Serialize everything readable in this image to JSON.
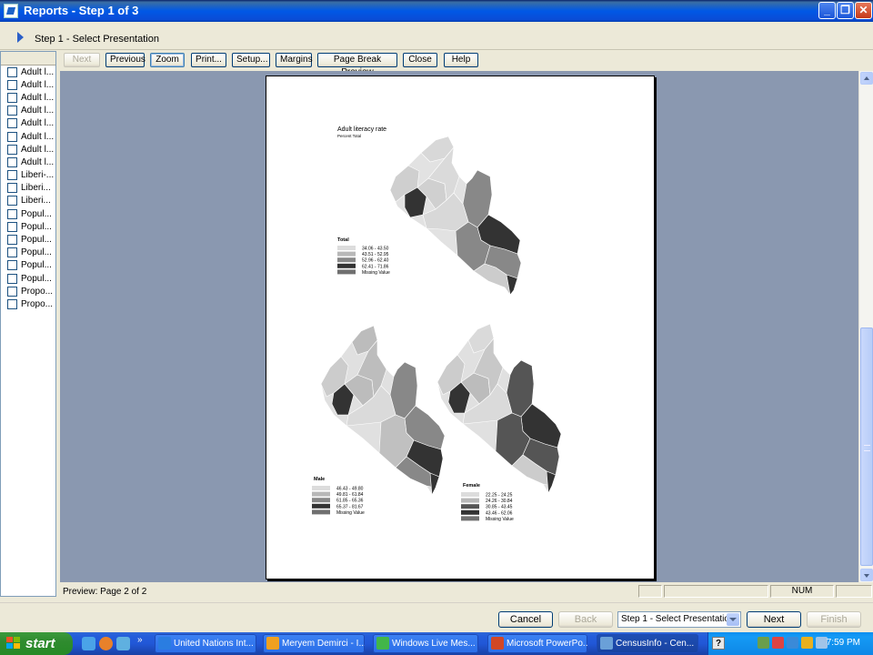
{
  "window": {
    "title": "Reports - Step 1 of 3",
    "minimize_glyph": "_",
    "maximize_glyph": "❐",
    "close_glyph": "✕"
  },
  "step": {
    "title": "Step 1 - Select Presentation"
  },
  "left_list": [
    "Adult l...",
    "Adult l...",
    "Adult l...",
    "Adult l...",
    "Adult l...",
    "Adult l...",
    "Adult l...",
    "Adult l...",
    "Liberi-...",
    "Liberi...",
    "Liberi...",
    "Popul...",
    "Popul...",
    "Popul...",
    "Popul...",
    "Popul...",
    "Popul...",
    "Propo...",
    "Propo..."
  ],
  "toolbar": {
    "next": "Next",
    "previous": "Previous",
    "zoom": "Zoom",
    "print": "Print...",
    "setup": "Setup...",
    "margins": "Margins",
    "page_break": "Page Break Preview",
    "close": "Close",
    "help": "Help"
  },
  "report": {
    "title": "Adult literacy rate",
    "subtitle": "Percent Total",
    "legend_total": {
      "title": "Total",
      "items": [
        {
          "label": "34.06 - 43.50",
          "color": "#dcdcdc"
        },
        {
          "label": "43.51 - 52.95",
          "color": "#b8b8b8"
        },
        {
          "label": "52.96 - 62.40",
          "color": "#888888"
        },
        {
          "label": "62.41 - 71.86",
          "color": "#333333"
        },
        {
          "label": "Missing Value",
          "color": "#707070"
        }
      ]
    },
    "legend_male": {
      "title": "Male",
      "items": [
        {
          "label": "46.43 - 49.80",
          "color": "#dcdcdc"
        },
        {
          "label": "49.81 - 61.84",
          "color": "#b8b8b8"
        },
        {
          "label": "61.85 - 65.36",
          "color": "#888888"
        },
        {
          "label": "65.37 - 81.67",
          "color": "#333333"
        },
        {
          "label": "Missing Value",
          "color": "#707070"
        }
      ]
    },
    "legend_female": {
      "title": "Female",
      "items": [
        {
          "label": "22.25 - 24.25",
          "color": "#dcdcdc"
        },
        {
          "label": "24.26 - 30.84",
          "color": "#b8b8b8"
        },
        {
          "label": "30.85 - 43.45",
          "color": "#555555"
        },
        {
          "label": "43.46 - 62.06",
          "color": "#333333"
        },
        {
          "label": "Missing Value",
          "color": "#707070"
        }
      ]
    }
  },
  "status": {
    "preview_text": "Preview: Page 2 of 2",
    "num": "NUM"
  },
  "bottom_nav": {
    "cancel": "Cancel",
    "back": "Back",
    "step_select_value": "Step 1 - Select Presentation",
    "next": "Next",
    "finish": "Finish"
  },
  "taskbar": {
    "start": "start",
    "overflow": "»",
    "tasks": [
      {
        "label": "United Nations Int...",
        "icon_color": "#2a7de1"
      },
      {
        "label": "Meryem Demirci - I...",
        "icon_color": "#f0a020"
      },
      {
        "label": "Windows Live Mes...",
        "icon_color": "#42b649"
      },
      {
        "label": "Microsoft PowerPo...",
        "icon_color": "#d24726"
      },
      {
        "label": "CensusInfo - Cen...",
        "icon_color": "#6aa0d8"
      }
    ],
    "help_glyph": "?",
    "clock": "7:59 PM"
  }
}
